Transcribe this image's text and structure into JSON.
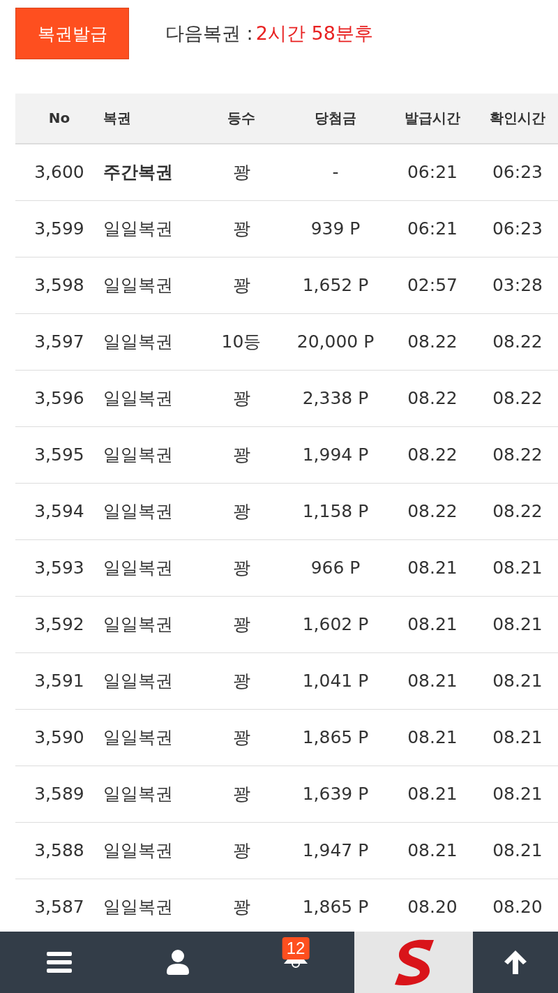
{
  "issue_button": "복권발급",
  "next": {
    "label": "다음복권 :",
    "time": "2시간 58분후"
  },
  "table": {
    "columns": [
      "No",
      "복권",
      "등수",
      "당첨금",
      "발급시간",
      "확인시간"
    ],
    "rows": [
      {
        "kind": "weekly",
        "cells": [
          "3,600",
          "주간복권",
          "꽝",
          "-",
          "06:21",
          "06:23"
        ]
      },
      {
        "kind": "daily",
        "cells": [
          "3,599",
          "일일복권",
          "꽝",
          "939 P",
          "06:21",
          "06:23"
        ]
      },
      {
        "kind": "daily",
        "cells": [
          "3,598",
          "일일복권",
          "꽝",
          "1,652 P",
          "02:57",
          "03:28"
        ]
      },
      {
        "kind": "daily",
        "cells": [
          "3,597",
          "일일복권",
          "10등",
          "20,000 P",
          "08.22",
          "08.22"
        ]
      },
      {
        "kind": "daily",
        "cells": [
          "3,596",
          "일일복권",
          "꽝",
          "2,338 P",
          "08.22",
          "08.22"
        ]
      },
      {
        "kind": "daily",
        "cells": [
          "3,595",
          "일일복권",
          "꽝",
          "1,994 P",
          "08.22",
          "08.22"
        ]
      },
      {
        "kind": "daily",
        "cells": [
          "3,594",
          "일일복권",
          "꽝",
          "1,158 P",
          "08.22",
          "08.22"
        ]
      },
      {
        "kind": "daily",
        "cells": [
          "3,593",
          "일일복권",
          "꽝",
          "966 P",
          "08.21",
          "08.21"
        ]
      },
      {
        "kind": "daily",
        "cells": [
          "3,592",
          "일일복권",
          "꽝",
          "1,602 P",
          "08.21",
          "08.21"
        ]
      },
      {
        "kind": "daily",
        "cells": [
          "3,591",
          "일일복권",
          "꽝",
          "1,041 P",
          "08.21",
          "08.21"
        ]
      },
      {
        "kind": "daily",
        "cells": [
          "3,590",
          "일일복권",
          "꽝",
          "1,865 P",
          "08.21",
          "08.21"
        ]
      },
      {
        "kind": "daily",
        "cells": [
          "3,589",
          "일일복권",
          "꽝",
          "1,639 P",
          "08.21",
          "08.21"
        ]
      },
      {
        "kind": "daily",
        "cells": [
          "3,588",
          "일일복권",
          "꽝",
          "1,947 P",
          "08.21",
          "08.21"
        ]
      },
      {
        "kind": "daily",
        "cells": [
          "3,587",
          "일일복권",
          "꽝",
          "1,865 P",
          "08.20",
          "08.20"
        ]
      }
    ]
  },
  "bottom_nav": {
    "notification_count": "12"
  }
}
